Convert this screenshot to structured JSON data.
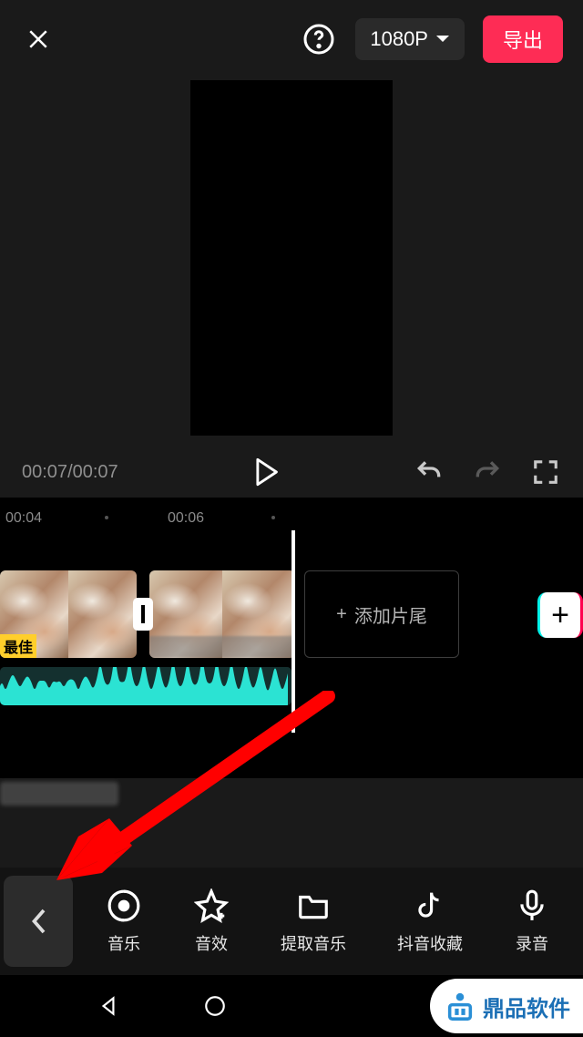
{
  "header": {
    "resolution_label": "1080P",
    "export_label": "导出"
  },
  "playback": {
    "current_time": "00:07",
    "total_time": "00:07"
  },
  "ruler": {
    "label_1": "00:04",
    "label_2": "00:06"
  },
  "timeline": {
    "clip_overlay_text": "最佳",
    "add_tail_label": "添加片尾"
  },
  "toolbar": {
    "items": [
      {
        "label": "音乐",
        "icon": "music-disc-icon"
      },
      {
        "label": "音效",
        "icon": "star-icon"
      },
      {
        "label": "提取音乐",
        "icon": "folder-icon"
      },
      {
        "label": "抖音收藏",
        "icon": "douyin-icon"
      },
      {
        "label": "录音",
        "icon": "mic-icon"
      }
    ]
  },
  "watermark": {
    "brand": "鼎品软件"
  }
}
